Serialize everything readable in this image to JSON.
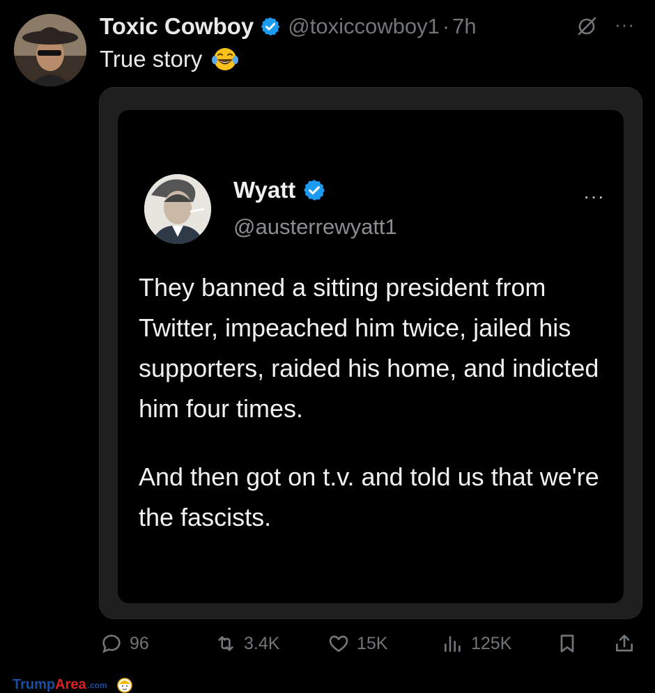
{
  "tweet": {
    "display_name": "Toxic Cowboy",
    "handle": "@toxiccowboy1",
    "separator": "·",
    "time": "7h",
    "text": "True story",
    "emoji": "face-with-tears-of-joy",
    "more": "···"
  },
  "quoted": {
    "display_name": "Wyatt",
    "handle": "@austerrewyatt1",
    "more": "···",
    "paragraph_1": "They banned a sitting president from Twitter, impeached him twice, jailed his supporters, raided his home, and indicted him four times.",
    "paragraph_2": "And then got on t.v. and told us that we're the fascists."
  },
  "actions": {
    "replies": "96",
    "reposts": "3.4K",
    "likes": "15K",
    "views": "125K"
  },
  "watermark": {
    "part1": "Trump",
    "part2": "Area",
    "part3": ".com"
  },
  "colors": {
    "background": "#000000",
    "verified": "#1d9bf0",
    "muted": "#71767b"
  }
}
